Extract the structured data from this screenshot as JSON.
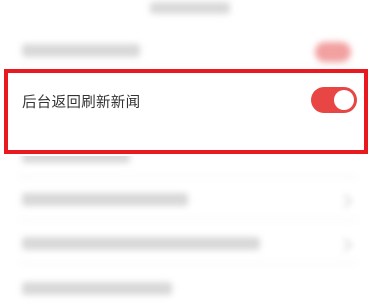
{
  "setting": {
    "label": "后台返回刷新新闻",
    "toggle_state": "on"
  },
  "colors": {
    "toggle_on": "#e84545",
    "highlight_border": "#e8191f",
    "blurred_toggle": "#f2a0a0"
  }
}
